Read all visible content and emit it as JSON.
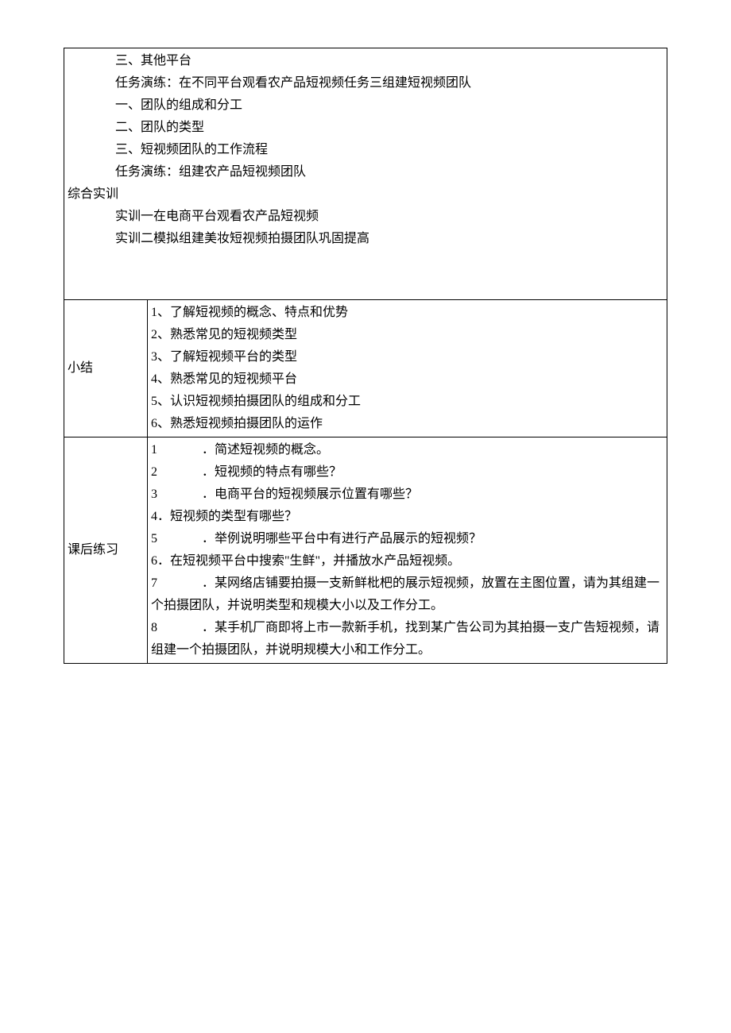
{
  "topSection": {
    "lines": [
      {
        "cls": "indent1",
        "text": "三、其他平台"
      },
      {
        "cls": "indent1",
        "text": "任务演练：在不同平台观看农产品短视频任务三组建短视频团队"
      },
      {
        "cls": "indent1",
        "text": "一、团队的组成和分工"
      },
      {
        "cls": "indent1",
        "text": "二、团队的类型"
      },
      {
        "cls": "indent1",
        "text": "三、短视频团队的工作流程"
      },
      {
        "cls": "indent1",
        "text": "任务演练：组建农产品短视频团队"
      },
      {
        "cls": "noindent",
        "text": "综合实训"
      },
      {
        "cls": "indent1",
        "text": "实训一在电商平台观看农产品短视频"
      },
      {
        "cls": "indent1",
        "text": "实训二模拟组建美妆短视频拍摄团队巩固提高"
      }
    ]
  },
  "summary": {
    "label": "小结",
    "items": [
      "1、了解短视频的概念、特点和优势",
      "2、熟悉常见的短视频类型",
      "3、了解短视频平台的类型",
      "4、熟悉常见的短视频平台",
      "5、认识短视频拍摄团队的组成和分工",
      "6、熟悉短视频拍摄团队的运作"
    ]
  },
  "exercises": {
    "label": "课后练习",
    "items": [
      {
        "num": "1",
        "gap": true,
        "text": "．简述短视频的概念。"
      },
      {
        "num": "2",
        "gap": true,
        "text": "．短视频的特点有哪些？"
      },
      {
        "num": "3",
        "gap": true,
        "text": "．电商平台的短视频展示位置有哪些？"
      },
      {
        "num": "4",
        "gap": false,
        "text": "．短视频的类型有哪些？"
      },
      {
        "num": "5",
        "gap": true,
        "text": "．举例说明哪些平台中有进行产品展示的短视频？"
      },
      {
        "num": "6",
        "gap": false,
        "text": "．在短视频平台中搜索\"生鲜\"，并播放水产品短视频。"
      },
      {
        "num": "7",
        "gap": true,
        "text": "．某网络店铺要拍摄一支新鲜枇杷的展示短视频，放置在主图位置，请为其组建一个拍摄团队，并说明类型和规模大小以及工作分工。"
      },
      {
        "num": "8",
        "gap": true,
        "text": "．某手机厂商即将上市一款新手机，找到某广告公司为其拍摄一支广告短视频，请组建一个拍摄团队，并说明规模大小和工作分工。"
      }
    ]
  }
}
